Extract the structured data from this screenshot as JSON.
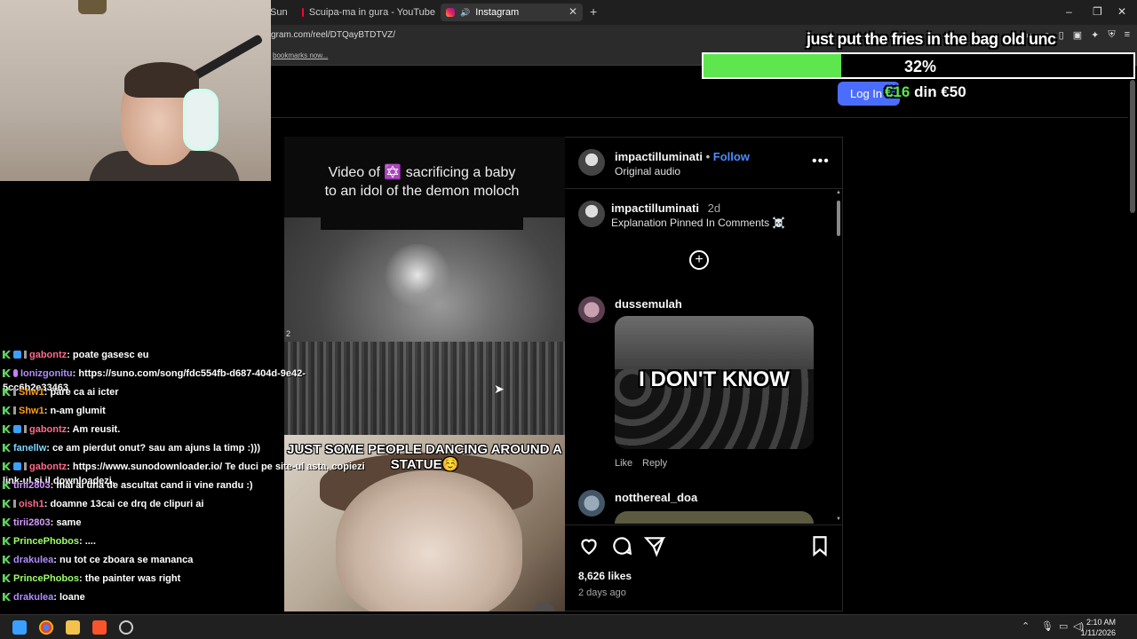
{
  "browser": {
    "tabs": [
      {
        "label": "Suno",
        "kind": "partial"
      },
      {
        "label": "Scuipa-ma in gura - YouTube",
        "kind": "yt"
      },
      {
        "label": "Instagram",
        "kind": "ig"
      }
    ],
    "url": "gram.com/reel/DTQayBTDTVZ/",
    "bookmarks_hint": "bookmarks now..."
  },
  "reel": {
    "caption": "Video of ✡️ sacrificing a baby to an idol of the demon moloch",
    "meme_text": "JUST SOME PEOPLE DANCING AROUND A STATUE☺️",
    "small_label": "2"
  },
  "post": {
    "author": "impactilluminati",
    "follow_label": "Follow",
    "audio": "Original audio",
    "caption_author": "impactilluminati",
    "caption_age": "2d",
    "caption_text": "Explanation Pinned In Comments ☠️",
    "comments": [
      {
        "user": "dussemulah",
        "gif_text": "I DON'T KNOW",
        "like_label": "Like",
        "reply_label": "Reply"
      },
      {
        "user": "notthereal_doa"
      }
    ],
    "likes": "8,626 likes",
    "posted": "2 days ago"
  },
  "overlay": {
    "goal_title": "just put the fries in the bag old unc",
    "goal_percent_label": "32%",
    "goal_fraction": 0.32,
    "login_label": "Log In",
    "amount_current": "€16",
    "amount_sep": " din ",
    "amount_target": "€50"
  },
  "chat": [
    {
      "user": "gabontz",
      "color": "#ff6b8b",
      "badges": [
        "green",
        "blue",
        "grey"
      ],
      "text": ": poate gasesc eu"
    },
    {
      "user": "Ionizgonitu",
      "color": "#b28cff",
      "badges": [
        "green",
        "mic"
      ],
      "text": ": https://suno.com/song/fdc554fb-d687-404d-9e42-",
      "cont": "5cc6b2e33463"
    },
    {
      "user": "Shw1",
      "color": "#ff9f1c",
      "badges": [
        "green",
        "grey"
      ],
      "text": ": pare ca ai icter"
    },
    {
      "user": "Shw1",
      "color": "#ff9f1c",
      "badges": [
        "green",
        "grey"
      ],
      "text": ": n-am glumit"
    },
    {
      "user": "gabontz",
      "color": "#ff6b8b",
      "badges": [
        "green",
        "blue",
        "grey"
      ],
      "text": ": Am reusit."
    },
    {
      "user": "fanellw",
      "color": "#7fd6ff",
      "badges": [
        "green"
      ],
      "text": ": ce am pierdut onut? sau am ajuns la timp :)))"
    },
    {
      "user": "gabontz",
      "color": "#ff6b8b",
      "badges": [
        "green",
        "blue",
        "grey"
      ],
      "text": ": https://www.sunodownloader.io/ Te duci pe site-ul asta, copiezi",
      "cont": "link-ul si il downloadezi."
    },
    {
      "user": "tirii2803",
      "color": "#d69cff",
      "badges": [
        "green"
      ],
      "text": ": mai ai una de ascultat cand ii vine randu :)"
    },
    {
      "user": "oish1",
      "color": "#ff6b8b",
      "badges": [
        "green",
        "grey"
      ],
      "text": ": doamne 13cai ce drq de clipuri ai"
    },
    {
      "user": "tirii2803",
      "color": "#d69cff",
      "badges": [
        "green"
      ],
      "text": ": same"
    },
    {
      "user": "PrincePhobos",
      "color": "#9cff6b",
      "badges": [
        "green"
      ],
      "text": ": ...."
    },
    {
      "user": "drakulea",
      "color": "#b28cff",
      "badges": [
        "green"
      ],
      "text": ": nu tot ce zboara se mananca"
    },
    {
      "user": "PrincePhobos",
      "color": "#9cff6b",
      "badges": [
        "green"
      ],
      "text": ": the painter was right"
    },
    {
      "user": "drakulea",
      "color": "#b28cff",
      "badges": [
        "green"
      ],
      "text": ": loane"
    }
  ],
  "taskbar": {
    "time": "2:10 AM",
    "date": "1/11/2026"
  }
}
